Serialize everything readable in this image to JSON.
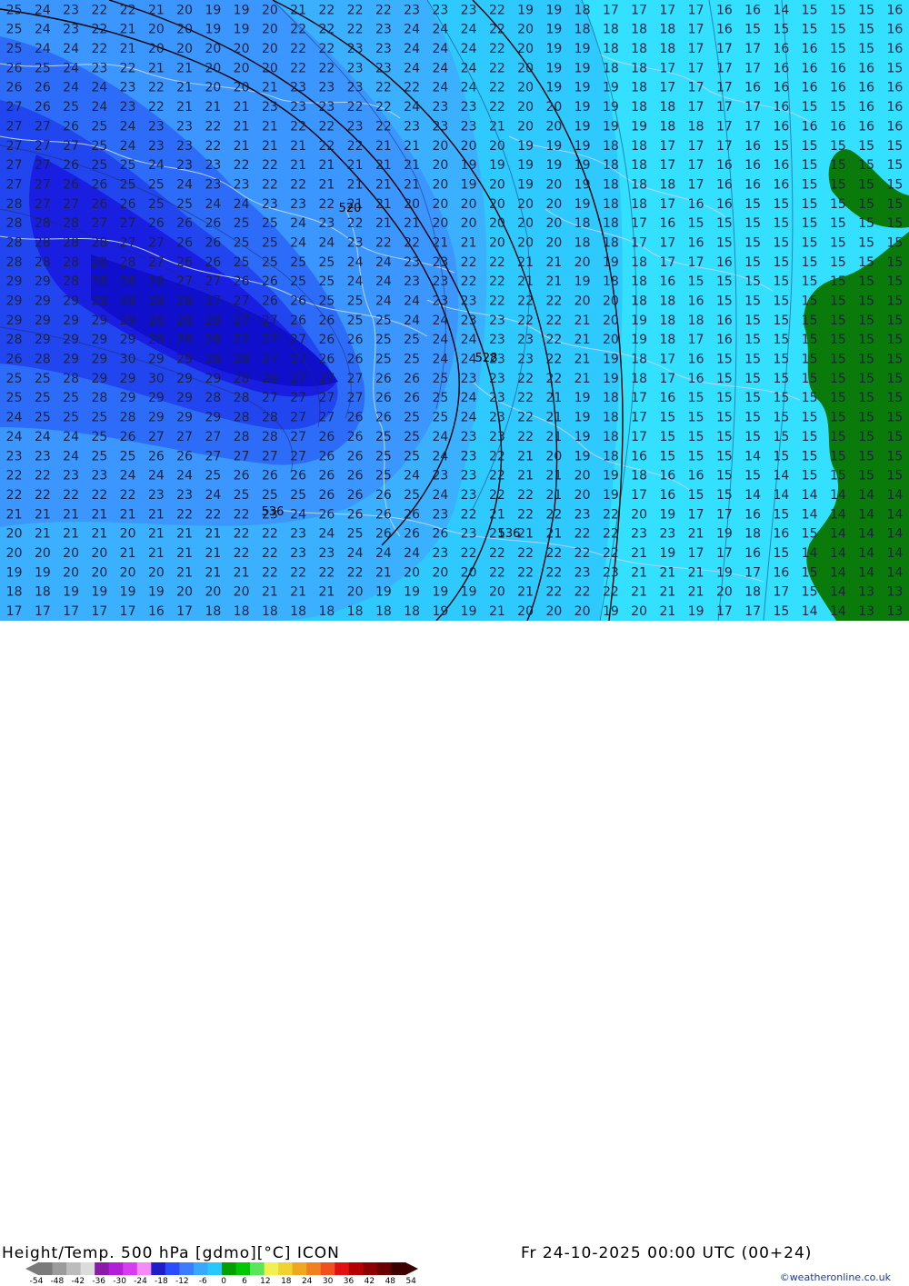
{
  "footer": {
    "title": "Height/Temp. 500 hPa [gdmo][°C] ICON",
    "valid_time": "Fr 24-10-2025 00:00 UTC (00+24)",
    "credit": "©weatheronline.co.uk"
  },
  "scale": {
    "ticks": [
      "-54",
      "-48",
      "-42",
      "-36",
      "-30",
      "-24",
      "-18",
      "-12",
      "-6",
      "0",
      "6",
      "12",
      "18",
      "24",
      "30",
      "36",
      "42",
      "48",
      "54"
    ],
    "colors": [
      "#7a7a7a",
      "#9b9b9b",
      "#bcbcbc",
      "#dcdcdc",
      "#8a1aa8",
      "#b21fd6",
      "#d83cf0",
      "#f58cf5",
      "#1e1ec8",
      "#2b4bff",
      "#3c7cff",
      "#38a8ff",
      "#28c8ff",
      "#00a000",
      "#00c800",
      "#5ae65a",
      "#f0f050",
      "#f0d230",
      "#f0a820",
      "#f08020",
      "#f05020",
      "#e01010",
      "#b40000",
      "#8c0000",
      "#6a0000",
      "#3c0000"
    ]
  },
  "map": {
    "land_color": "#0a7a0a",
    "contour_value_rows": [
      "25 24 23 22 22 21 20 19 19 20 21 22 22 22 23 23 23 22 19 19 18 17 17 17 17 16 16 14 15 15 15 16",
      "25 24 23 22 21 20 20 19 19 20 22 22 22 23 24 24 24 22 20 19 18 18 18 18 17 16 15 15 15 15 15 16",
      "25 24 24 22 21 20 20 20 20 20 22 22 23 23 24 24 24 22 20 19 19 18 18 18 17 17 17 16 16 15 15 16",
      "26 25 24 23 22 21 21 20 20 20 22 22 23 23 24 24 24 22 20 19 19 18 18 17 17 17 17 16 16 16 16 15",
      "26 26 24 24 23 22 21 20 20 21 23 23 23 22 22 24 24 22 20 19 19 19 18 17 17 17 16 16 16 16 16 16",
      "27 26 25 24 23 22 21 21 21 23 23 23 22 22 24 23 23 22 20 20 19 19 18 18 17 17 17 16 15 15 16 16",
      "27 27 26 25 24 23 23 22 21 21 22 22 23 22 23 23 23 21 20 20 19 19 19 18 18 17 17 16 16 16 16 16",
      "27 27 27 25 24 23 23 22 21 21 21 22 22 21 21 20 20 20 19 19 19 18 18 17 17 17 16 15 15 15 15 15",
      "27 27 26 25 25 24 23 23 22 22 21 21 21 21 21 20 19 19 19 19 19 18 18 17 17 16 16 16 15 15 15 15",
      "27 27 26 26 25 25 24 23 23 22 22 21 21 21 21 20 19 20 19 20 19 18 18 18 17 16 16 16 15 15 15 15",
      "28 27 27 26 26 25 25 24 24 23 23 22 21 21 20 20 20 20 20 20 19 18 18 17 16 16 15 15 15 15 15 15",
      "28 28 28 27 27 26 26 26 25 25 24 23 22 21 21 20 20 20 20 20 18 18 17 16 15 15 15 15 15 15 15 15",
      "28 28 28 28 27 27 26 26 25 25 24 24 23 22 22 21 21 20 20 20 18 18 17 17 16 15 15 15 15 15 15 15",
      "28 28 28 28 28 27 26 26 25 25 25 25 24 24 23 23 22 22 21 21 20 19 18 17 17 16 15 15 15 15 15 15",
      "29 29 28 28 28 28 27 27 26 26 25 25 24 24 23 23 22 22 21 21 19 18 18 16 15 15 15 15 15 15 15 15",
      "29 29 29 28 28 28 28 27 27 26 26 25 25 24 24 23 23 22 22 22 20 20 18 18 16 15 15 15 15 15 15 15",
      "29 29 29 29 29 28 28 28 27 27 26 26 25 25 24 24 23 23 22 22 21 20 19 18 18 16 15 15 15 15 15 15",
      "28 29 29 29 29 29 28 28 27 27 27 26 26 25 25 24 24 23 23 22 21 20 19 18 17 16 15 15 15 15 15 15",
      "26 28 29 29 30 29 29 28 28 27 27 26 26 25 25 24 24 23 23 22 21 19 18 17 16 15 15 15 15 15 15 15",
      "25 25 28 29 29 30 29 29 28 28 27 27 27 26 26 25 23 23 22 22 21 19 18 17 16 15 15 15 15 15 15 15",
      "25 25 25 28 29 29 29 28 28 27 27 27 27 26 26 25 24 23 22 21 19 18 17 16 15 15 15 15 15 15 15 15",
      "24 25 25 25 28 29 29 29 28 28 27 27 26 26 25 25 24 23 22 21 19 18 17 15 15 15 15 15 15 15 15 15",
      "24 24 24 25 26 27 27 27 28 28 27 26 26 25 25 24 23 23 22 21 19 18 17 15 15 15 15 15 15 15 15 15",
      "23 23 24 25 25 26 26 27 27 27 27 26 26 25 25 24 23 22 21 20 19 18 16 15 15 15 14 15 15 15 15 15",
      "22 22 23 23 24 24 24 25 26 26 26 26 26 25 24 23 23 22 21 21 20 19 18 16 16 15 15 14 15 15 15 15",
      "22 22 22 22 22 23 23 24 25 25 25 26 26 26 25 24 23 22 22 21 20 19 17 16 15 15 14 14 14 14 14 14",
      "21 21 21 21 21 21 22 22 22 23 24 26 26 26 26 23 22 21 22 22 23 22 20 19 17 17 16 15 14 14 14 14",
      "20 21 21 21 20 21 21 21 22 22 23 24 25 26 26 26 23 21 21 21 22 22 23 23 21 19 18 16 15 14 14 14",
      "20 20 20 20 21 21 21 21 22 22 23 23 24 24 24 23 22 22 22 22 22 22 21 19 17 17 16 15 14 14 14 14",
      "19 19 20 20 20 20 21 21 21 22 22 22 22 21 20 20 20 22 22 22 23 23 21 21 21 19 17 16 15 14 14 14",
      "18 18 19 19 19 19 20 20 20 21 21 21 20 19 19 19 19 20 21 22 22 22 21 21 21 20 18 17 15 14 13 13",
      "17 17 17 17 17 16 17 18 18 18 18 18 18 18 18 19 19 21 20 20 20 19 20 21 19 17 17 15 14 14 13 13"
    ],
    "height_labels": [
      "520",
      "528",
      "536",
      "536"
    ]
  }
}
